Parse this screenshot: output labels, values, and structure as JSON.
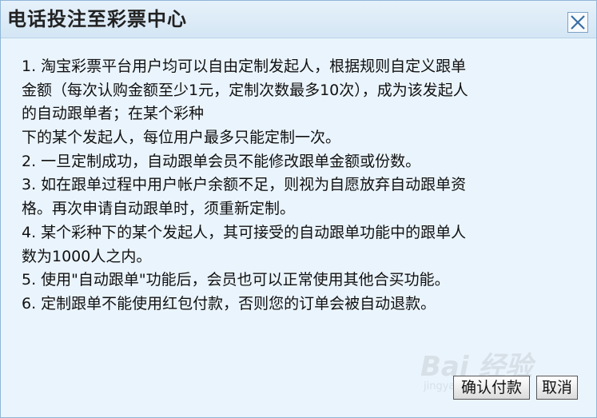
{
  "dialog": {
    "title": "电话投注至彩票中心",
    "close_icon": "close-icon"
  },
  "content": {
    "lines": [
      "1. 淘宝彩票平台用户均可以自由定制发起人，根据规则自定义跟单",
      "金额（每次认购金额至少1元，定制次数最多10次），成为该发起人",
      "的自动跟单者；在某个彩种",
      "下的某个发起人，每位用户最多只能定制一次。",
      "2. 一旦定制成功，自动跟单会员不能修改跟单金额或份数。",
      "3. 如在跟单过程中用户帐户余额不足，则视为自愿放弃自动跟单资",
      "格。再次申请自动跟单时，须重新定制。",
      "4. 某个彩种下的某个发起人，其可接受的自动跟单功能中的跟单人",
      "数为1000人之内。",
      "5. 使用\"自动跟单\"功能后，会员也可以正常使用其他合买功能。",
      "6. 定制跟单不能使用红包付款，否则您的订单会被自动退款。"
    ]
  },
  "buttons": {
    "confirm_label": "确认付款",
    "cancel_label": "取消"
  },
  "watermark": {
    "main": "Bai 经验",
    "sub": "jingyan.baidu.com"
  },
  "colors": {
    "dialog_background": "#eaf4fc",
    "titlebar_background": "#d4e6f4",
    "close_icon": "#3a6ea5"
  }
}
